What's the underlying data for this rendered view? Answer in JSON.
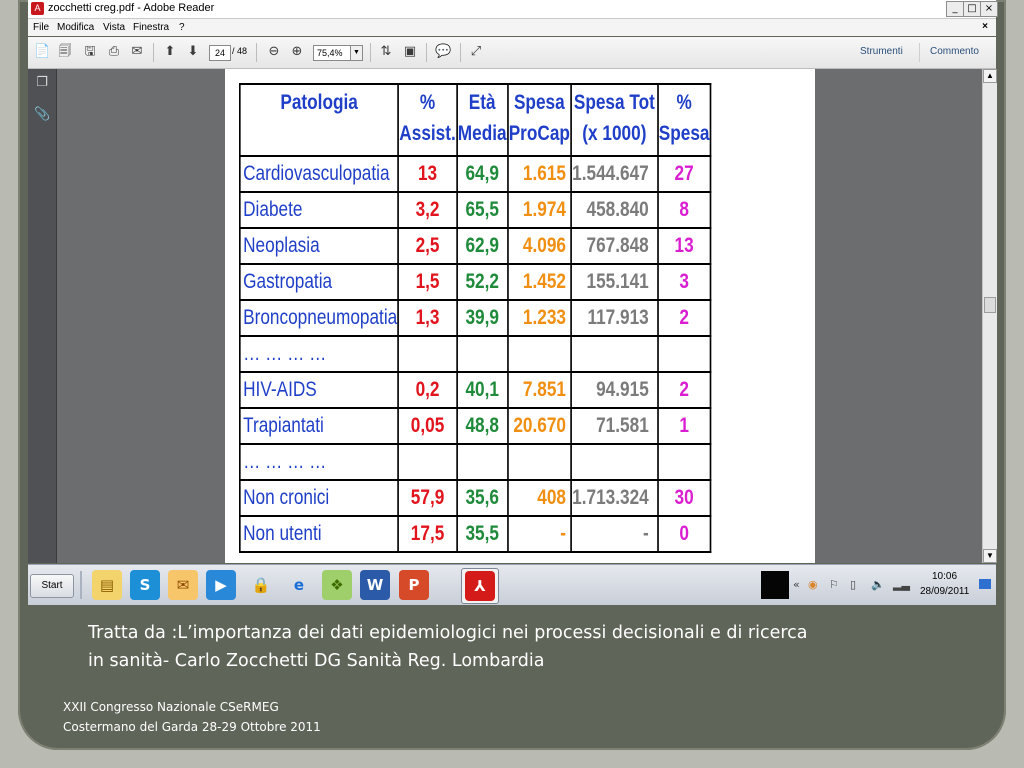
{
  "window": {
    "title": "zocchetti creg.pdf - Adobe Reader",
    "app_icon": "adobe-reader-icon"
  },
  "window_controls": {
    "minimize": "_",
    "restore": "□",
    "close": "×"
  },
  "menu": {
    "items": [
      "File",
      "Modifica",
      "Vista",
      "Finestra",
      "?"
    ],
    "doc_close": "×"
  },
  "toolbar": {
    "page_current": "24",
    "page_total": "/ 48",
    "zoom": "75,4%",
    "strumenti": "Strumenti",
    "commento": "Commento"
  },
  "table": {
    "headers": [
      "Patologia",
      "% Assist.",
      "Età Media",
      "Spesa ProCap",
      "Spesa Tot (x 1000)",
      "% Spesa"
    ],
    "header_lines": [
      [
        "Patologia",
        ""
      ],
      [
        "%",
        "Assist."
      ],
      [
        "Età",
        "Media"
      ],
      [
        "Spesa",
        "ProCap"
      ],
      [
        "Spesa Tot",
        "(x 1000)"
      ],
      [
        "%",
        "Spesa"
      ]
    ],
    "rows": [
      [
        "Cardiovasculopatia",
        "13",
        "64,9",
        "1.615",
        "1.544.647",
        "27"
      ],
      [
        "Diabete",
        "3,2",
        "65,5",
        "1.974",
        "458.840",
        "8"
      ],
      [
        "Neoplasia",
        "2,5",
        "62,9",
        "4.096",
        "767.848",
        "13"
      ],
      [
        "Gastropatia",
        "1,5",
        "52,2",
        "1.452",
        "155.141",
        "3"
      ],
      [
        "Broncopneumopatia",
        "1,3",
        "39,9",
        "1.233",
        "117.913",
        "2"
      ],
      [
        "… … … …",
        "",
        "",
        "",
        "",
        ""
      ],
      [
        "HIV-AIDS",
        "0,2",
        "40,1",
        "7.851",
        "94.915",
        "2"
      ],
      [
        "Trapiantati",
        "0,05",
        "48,8",
        "20.670",
        "71.581",
        "1"
      ],
      [
        "… … … …",
        "",
        "",
        "",
        "",
        ""
      ],
      [
        "Non cronici",
        "57,9",
        "35,6",
        "408",
        "1.713.324",
        "30"
      ],
      [
        "Non utenti",
        "17,5",
        "35,5",
        "-",
        "-",
        "0"
      ]
    ]
  },
  "taskbar": {
    "start_label": "Start",
    "clock_time": "10:06",
    "clock_date": "28/09/2011"
  },
  "caption": {
    "line1": "Tratta da :L’importanza dei dati epidemiologici nei processi decisionali e di ricerca",
    "line2": "in sanità- Carlo Zocchetti DG Sanità Reg. Lombardia"
  },
  "footer": {
    "line1": "XXII Congresso Nazionale CSeRMEG",
    "line2": "Costermano del Garda 28-29 Ottobre 2011"
  },
  "colors": {
    "slide_bg": "#5f6558",
    "header_blue": "#1f3fc8",
    "assist_red": "#e1141d",
    "eta_green": "#1e8a3a",
    "spesa_orange": "#f08f11",
    "tot_gray": "#7b7b7b",
    "pct_magenta": "#d91fd1"
  }
}
